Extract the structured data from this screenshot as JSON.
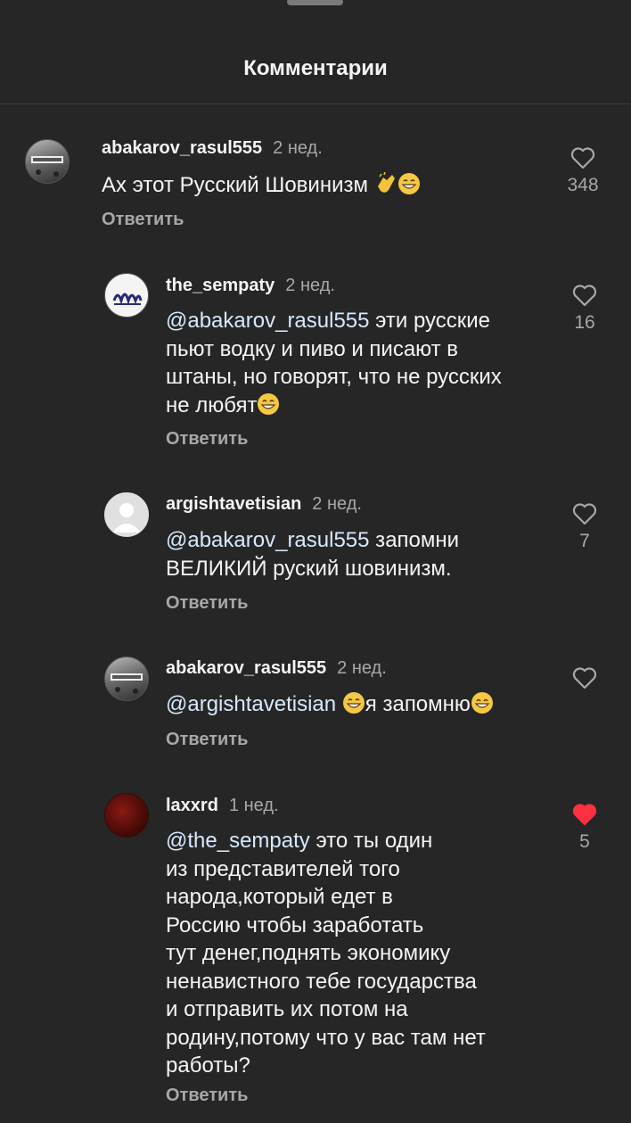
{
  "header": {
    "title": "Комментарии"
  },
  "reply_label": "Ответить",
  "comments": [
    {
      "user": "abakarov_rasul555",
      "time": "2 нед.",
      "text": "Ах этот Русский Шовинизм",
      "likes": "348",
      "liked": false
    },
    {
      "user": "the_sempaty",
      "time": "2 нед.",
      "mention": "@abakarov_rasul555",
      "text": " эти русские\nпьют водку и пиво и писают в\nштаны, но говорят, что не русских\nне любят",
      "likes": "16",
      "liked": false
    },
    {
      "user": "argishtavetisian",
      "time": "2 нед.",
      "mention": "@abakarov_rasul555",
      "text": " запомни\nВЕЛИКИЙ руский шовинизм.",
      "likes": "7",
      "liked": false
    },
    {
      "user": "abakarov_rasul555",
      "time": "2 нед.",
      "mention": "@argishtavetisian",
      "text": "я запомню",
      "likes": "",
      "liked": false
    },
    {
      "user": "laxxrd",
      "time": "1 нед.",
      "mention": "@the_sempaty",
      "text": " это ты один\nиз представителей того\nнарода,который едет в\nРоссию чтобы заработать\nтут денег,поднять экономику\nненавистного тебе государства\nи отправить их потом на\nродину,потому что у вас там нет\nработы?",
      "likes": "5",
      "liked": true
    }
  ],
  "colors": {
    "background": "#262626",
    "liked": "#ff3040",
    "secondary": "#a8a8a8"
  },
  "icons": [
    "heart-outline-icon",
    "heart-filled-icon",
    "clapping-hands-emoji",
    "grinning-sweat-emoji",
    "grinning-emoji"
  ]
}
